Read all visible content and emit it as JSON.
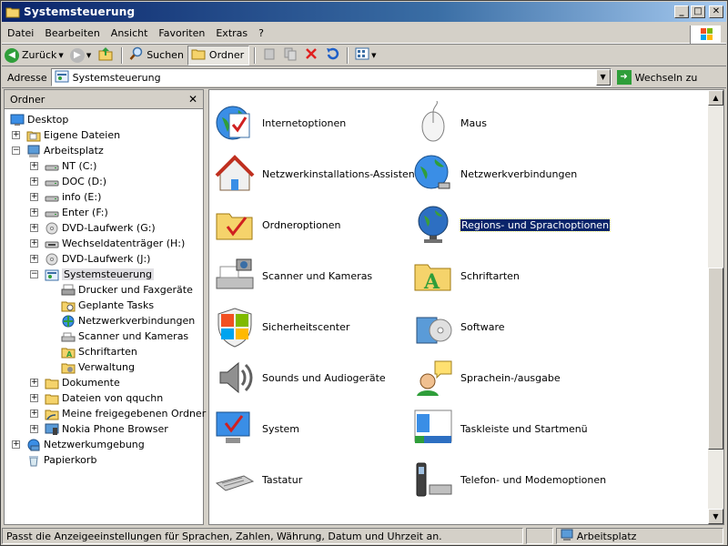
{
  "window": {
    "title": "Systemsteuerung"
  },
  "menu": {
    "items": [
      "Datei",
      "Bearbeiten",
      "Ansicht",
      "Favoriten",
      "Extras",
      "?"
    ]
  },
  "toolbar": {
    "back_label": "Zurück",
    "search_label": "Suchen",
    "folders_label": "Ordner"
  },
  "address": {
    "label": "Adresse",
    "value": "Systemsteuerung",
    "go_label": "Wechseln zu"
  },
  "folder_pane": {
    "title": "Ordner",
    "tree": [
      {
        "label": "Desktop",
        "icon": "desktop-icon"
      },
      {
        "label": "Eigene Dateien",
        "icon": "my-documents-icon"
      },
      {
        "label": "Arbeitsplatz",
        "icon": "my-computer-icon"
      },
      {
        "label": "NT (C:)",
        "icon": "drive-icon"
      },
      {
        "label": "DOC (D:)",
        "icon": "drive-icon"
      },
      {
        "label": "info (E:)",
        "icon": "drive-icon"
      },
      {
        "label": "Enter (F:)",
        "icon": "drive-icon"
      },
      {
        "label": "DVD-Laufwerk (G:)",
        "icon": "dvd-drive-icon"
      },
      {
        "label": "Wechseldatenträger (H:)",
        "icon": "removable-drive-icon"
      },
      {
        "label": "DVD-Laufwerk (J:)",
        "icon": "dvd-drive-icon"
      },
      {
        "label": "Systemsteuerung",
        "icon": "control-panel-icon"
      },
      {
        "label": "Drucker und Faxgeräte",
        "icon": "printer-icon"
      },
      {
        "label": "Geplante Tasks",
        "icon": "scheduled-tasks-icon"
      },
      {
        "label": "Netzwerkverbindungen",
        "icon": "network-icon"
      },
      {
        "label": "Scanner und Kameras",
        "icon": "scanner-icon"
      },
      {
        "label": "Schriftarten",
        "icon": "fonts-folder-icon"
      },
      {
        "label": "Verwaltung",
        "icon": "admin-tools-icon"
      },
      {
        "label": "Dokumente",
        "icon": "folder-icon"
      },
      {
        "label": "Dateien von qquchn",
        "icon": "folder-icon"
      },
      {
        "label": "Meine freigegebenen Ordner",
        "icon": "shared-folder-icon"
      },
      {
        "label": "Nokia Phone Browser",
        "icon": "phone-browser-icon"
      },
      {
        "label": "Netzwerkumgebung",
        "icon": "network-places-icon"
      },
      {
        "label": "Papierkorb",
        "icon": "recycle-bin-icon"
      }
    ]
  },
  "content": {
    "items_left": [
      {
        "label": "Internetoptionen",
        "icon": "internet-options-icon"
      },
      {
        "label": "Netzwerkinstallations-Assistent",
        "icon": "network-setup-icon"
      },
      {
        "label": "Ordneroptionen",
        "icon": "folder-options-icon"
      },
      {
        "label": "Scanner und Kameras",
        "icon": "scanner-camera-icon"
      },
      {
        "label": "Sicherheitscenter",
        "icon": "security-center-icon"
      },
      {
        "label": "Sounds und Audiogeräte",
        "icon": "sound-icon"
      },
      {
        "label": "System",
        "icon": "system-icon"
      },
      {
        "label": "Tastatur",
        "icon": "keyboard-icon"
      }
    ],
    "items_right": [
      {
        "label": "Maus",
        "icon": "mouse-icon"
      },
      {
        "label": "Netzwerkverbindungen",
        "icon": "network-connections-icon"
      },
      {
        "label": "Regions- und Sprachoptionen",
        "icon": "globe-icon"
      },
      {
        "label": "Schriftarten",
        "icon": "fonts-icon"
      },
      {
        "label": "Software",
        "icon": "software-icon"
      },
      {
        "label": "Sprachein-/ausgabe",
        "icon": "speech-icon"
      },
      {
        "label": "Taskleiste und Startmenü",
        "icon": "taskbar-icon"
      },
      {
        "label": "Telefon- und Modemoptionen",
        "icon": "phone-modem-icon"
      }
    ]
  },
  "status": {
    "text": "Passt die Anzeigeeinstellungen für Sprachen, Zahlen, Währung, Datum und Uhrzeit an.",
    "zone": "Arbeitsplatz"
  },
  "colors": {
    "titlebar": "#0a246a",
    "selection": "#0a246a",
    "face": "#d4d0c8"
  }
}
